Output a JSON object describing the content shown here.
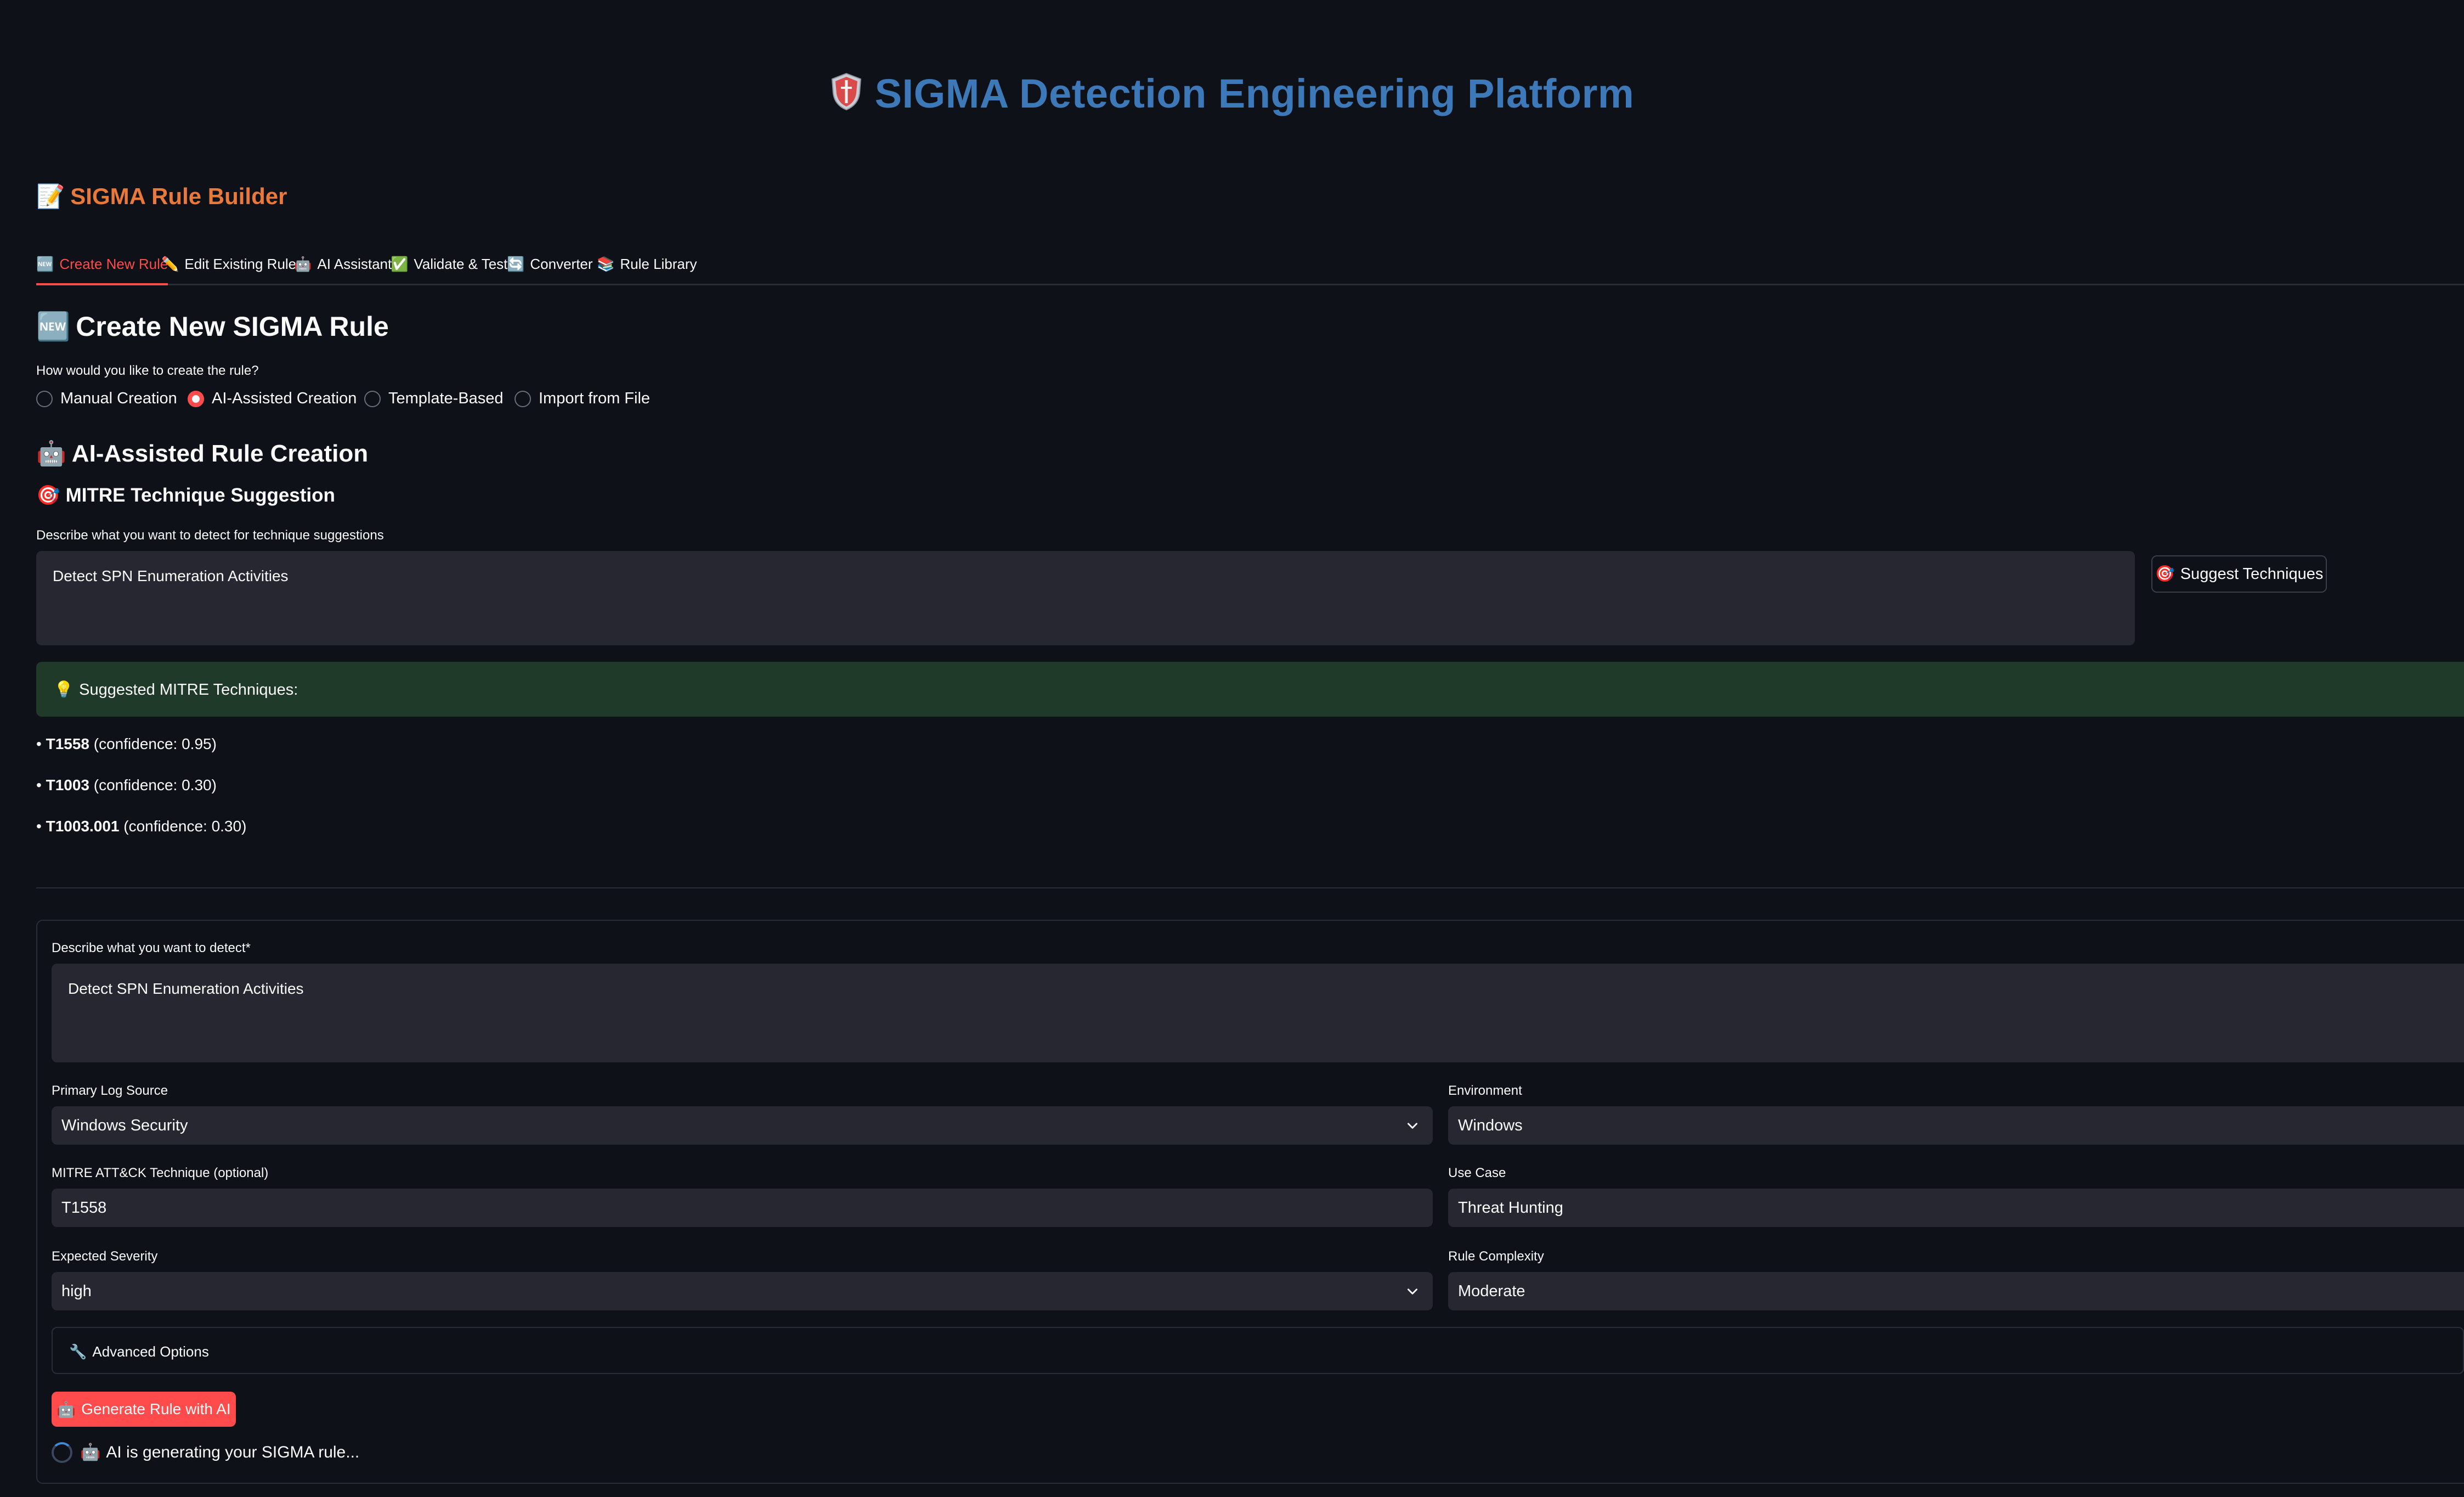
{
  "header": {
    "title": "SIGMA Detection Engineering Platform",
    "icon": "shield-icon"
  },
  "builder": {
    "title": "SIGMA Rule Builder",
    "icon": "memo-icon"
  },
  "tabs": [
    {
      "icon": "🆕",
      "label": "Create New Rule",
      "active": true
    },
    {
      "icon": "✏️",
      "label": "Edit Existing Rule",
      "active": false
    },
    {
      "icon": "🤖",
      "label": "AI Assistant",
      "active": false
    },
    {
      "icon": "✅",
      "label": "Validate & Test",
      "active": false
    },
    {
      "icon": "🔄",
      "label": "Converter",
      "active": false
    },
    {
      "icon": "📚",
      "label": "Rule Library",
      "active": false
    }
  ],
  "create": {
    "heading_icon": "🆕",
    "heading": "Create New SIGMA Rule",
    "method_question": "How would you like to create the rule?",
    "methods": [
      "Manual Creation",
      "AI-Assisted Creation",
      "Template-Based",
      "Import from File"
    ],
    "selected_method": "AI-Assisted Creation"
  },
  "ai": {
    "heading_icon": "🤖",
    "heading": "AI-Assisted Rule Creation",
    "mitre_icon": "🎯",
    "mitre_heading": "MITRE Technique Suggestion",
    "suggest_prompt_label": "Describe what you want to detect for technique suggestions",
    "suggest_prompt_value": "Detect SPN Enumeration Activities",
    "suggest_button_icon": "🎯",
    "suggest_button": "Suggest Techniques",
    "suggested_icon": "💡",
    "suggested_header": "Suggested MITRE Techniques:",
    "suggestions": [
      {
        "id": "T1558",
        "text": "(confidence: 0.95)"
      },
      {
        "id": "T1003",
        "text": "(confidence: 0.30)"
      },
      {
        "id": "T1003.001",
        "text": "(confidence: 0.30)"
      }
    ]
  },
  "form": {
    "describe_label": "Describe what you want to detect*",
    "describe_value": "Detect SPN Enumeration Activities",
    "log_source_label": "Primary Log Source",
    "log_source_value": "Windows Security",
    "environment_label": "Environment",
    "environment_value": "Windows",
    "mitre_label": "MITRE ATT&CK Technique (optional)",
    "mitre_value": "T1558",
    "use_case_label": "Use Case",
    "use_case_value": "Threat Hunting",
    "severity_label": "Expected Severity",
    "severity_value": "high",
    "complexity_label": "Rule Complexity",
    "complexity_value": "Moderate",
    "advanced_icon": "🔧",
    "advanced_label": "Advanced Options",
    "generate_icon": "🤖",
    "generate_button": "Generate Rule with AI",
    "status_icon": "🤖",
    "status_text": "AI is generating your SIGMA rule..."
  },
  "colors": {
    "background": "#0e1117",
    "title_blue": "#3d79b8",
    "section_orange": "#e8793a",
    "accent_red": "#ff4b4b",
    "success_bg": "#1f3a29"
  }
}
